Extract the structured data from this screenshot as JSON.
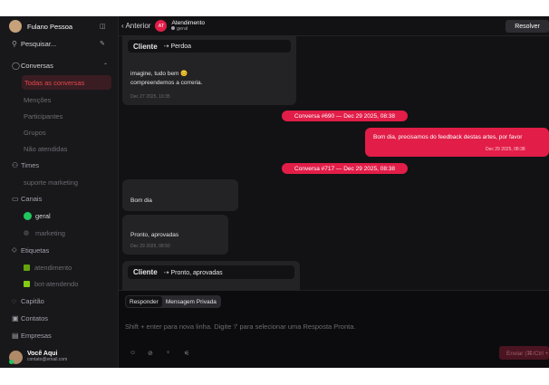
{
  "sidebar": {
    "user_name": "Fulano Pessoa",
    "search_placeholder": "Pesquisar...",
    "conversas": "Conversas",
    "todas": "Todas as conversas",
    "mencoes": "Menções",
    "participantes": "Participantes",
    "grupos": "Grupos",
    "nao_atendidas": "Não atendidas",
    "times": "Times",
    "suporte": "suporte marketing",
    "canais": "Canais",
    "geral": "geral",
    "marketing": "marketing",
    "etiquetas": "Etiquetas",
    "atendimento": "atendimento",
    "bot": "bot-atendendo",
    "capitao": "Capitão",
    "contatos": "Contatos",
    "empresas": "Empresas",
    "profile_name": "Você Aqui",
    "profile_email": "contato@email.com"
  },
  "header": {
    "back": "Anterior",
    "avatar_initials": "AT",
    "title": "Atendimento",
    "channel": "geral",
    "resolve": "Resolver"
  },
  "messages": {
    "quote1_name": "Cliente",
    "quote1_text": "⇢ Perdoa",
    "msg1_line1": "imagine, tudo bem 😊",
    "msg1_line2": "compreendemos a correria.",
    "msg1_time": "Dec 27 2025, 19:35",
    "divider1": "Conversa #690 — Dec 29 2025, 08:38",
    "out_text": "Bom dia, precisamos do feedback destas artes, por favor",
    "out_time": "Dec 29 2025, 08:38",
    "divider2": "Conversa #717 — Dec 29 2025, 08:38",
    "msg2": "Bom dia",
    "msg3": "Pronto, aprovadas",
    "msg3_time": "Dec 29 2025, 08:50",
    "quote2_name": "Cliente",
    "quote2_text": "⇢ Pronto, aprovadas"
  },
  "composer": {
    "tab_reply": "Responder",
    "tab_private": "Mensagem Privada",
    "placeholder": "Shift + enter para nova linha. Digite '/' para selecionar uma Resposta Pronta.",
    "send": "Enviar (⌘/Ctrl + ↵)"
  },
  "colors": {
    "accent": "#e11d48",
    "background": "#121214",
    "sidebar": "#18181b"
  }
}
